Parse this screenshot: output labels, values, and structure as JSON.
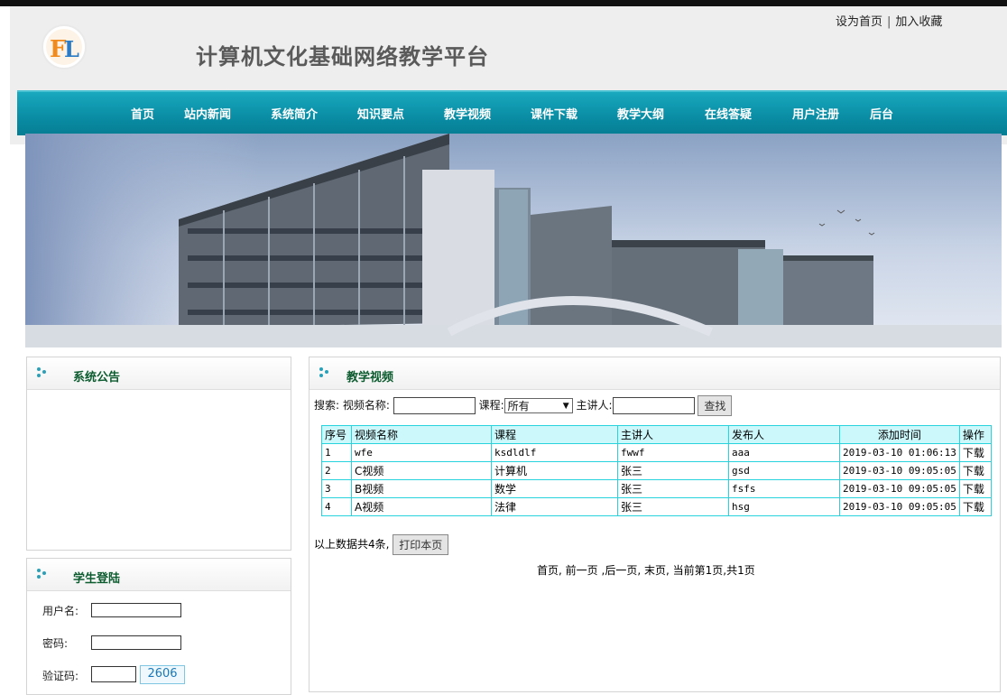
{
  "header": {
    "title": "计算机文化基础网络教学平台",
    "logo_text": "FL",
    "links": {
      "home": "设为首页",
      "separator": "|",
      "favorite": "加入收藏"
    }
  },
  "nav": {
    "items": [
      "首页",
      "站内新闻",
      "系统简介",
      "知识要点",
      "教学视频",
      "课件下载",
      "教学大纲",
      "在线答疑",
      "用户注册",
      "后台"
    ]
  },
  "notice": {
    "title": "系统公告"
  },
  "login": {
    "title": "学生登陆",
    "username_label": "用户名:",
    "password_label": "密码:",
    "captcha_label": "验证码:",
    "captcha_value": "2606"
  },
  "video": {
    "title": "教学视频",
    "search": {
      "label": "搜索:",
      "name_label": "视频名称:",
      "course_label": "课程:",
      "course_selected": "所有",
      "lecturer_label": "主讲人:",
      "button": "查找"
    },
    "columns": [
      "序号",
      "视频名称",
      "课程",
      "主讲人",
      "发布人",
      "添加时间",
      "操作"
    ],
    "rows": [
      {
        "no": "1",
        "name": "wfe",
        "course": "ksdldlf",
        "lecturer": "fwwf",
        "publisher": "aaa",
        "time": "2019-03-10 01:06:13",
        "action": "下载"
      },
      {
        "no": "2",
        "name": "C视频",
        "course": "计算机",
        "lecturer": "张三",
        "publisher": "gsd",
        "time": "2019-03-10 09:05:05",
        "action": "下载"
      },
      {
        "no": "3",
        "name": "B视频",
        "course": "数学",
        "lecturer": "张三",
        "publisher": "fsfs",
        "time": "2019-03-10 09:05:05",
        "action": "下载"
      },
      {
        "no": "4",
        "name": "A视频",
        "course": "法律",
        "lecturer": "张三",
        "publisher": "hsg",
        "time": "2019-03-10 09:05:05",
        "action": "下载"
      }
    ],
    "summary": "以上数据共4条,",
    "print_button": "打印本页",
    "pager": {
      "first": "首页,",
      "prev": "前一页",
      "next": ",后一页,",
      "last": "末页,",
      "status": "当前第1页,共1页"
    }
  },
  "colors": {
    "nav": "#0a8ea6",
    "panel_title": "#0d5c30",
    "table_border": "#29d3dd",
    "table_header": "#ccf8fc"
  }
}
